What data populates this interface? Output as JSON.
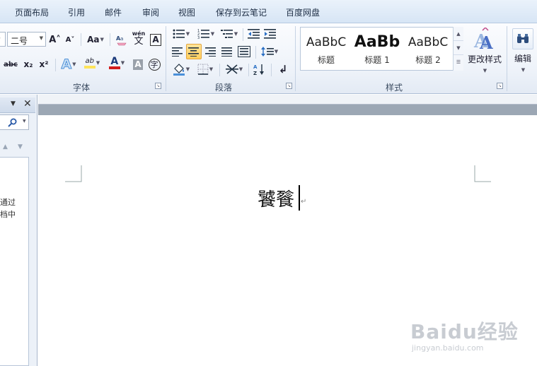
{
  "tabs": [
    "页面布局",
    "引用",
    "邮件",
    "审阅",
    "视图",
    "保存到云笔记",
    "百度网盘"
  ],
  "font_group": {
    "size_value": "二号",
    "grow_icon": "A˄",
    "shrink_icon": "A˅",
    "case_label": "Aa",
    "strike": "abc",
    "subscript": "x₂",
    "superscript": "x²",
    "phonetic": "wén",
    "charborder": "A",
    "effect": "A",
    "highlight": "ab",
    "color": "A",
    "shade": "A",
    "enclose": "字",
    "label": "字体"
  },
  "paragraph_group": {
    "label": "段落"
  },
  "styles_group": {
    "label": "样式",
    "items": [
      {
        "sample": "AaBbC",
        "name": "标题"
      },
      {
        "sample": "AaBb",
        "name": "标题 1"
      },
      {
        "sample": "AaBbC",
        "name": "标题 2"
      }
    ],
    "change_styles": "更改样式",
    "edit": "编辑"
  },
  "left_pane": {
    "text_line1": "通过",
    "text_line2": "档中"
  },
  "document": {
    "text": "饕餮",
    "para_mark": "↵"
  },
  "watermark": {
    "main": "Baidu经验",
    "url": "jingyan.baidu.com"
  },
  "colors": {
    "accent_tab": "#d7e5f5",
    "highlight": "#ffe45a",
    "font_red": "#d11c1c"
  }
}
